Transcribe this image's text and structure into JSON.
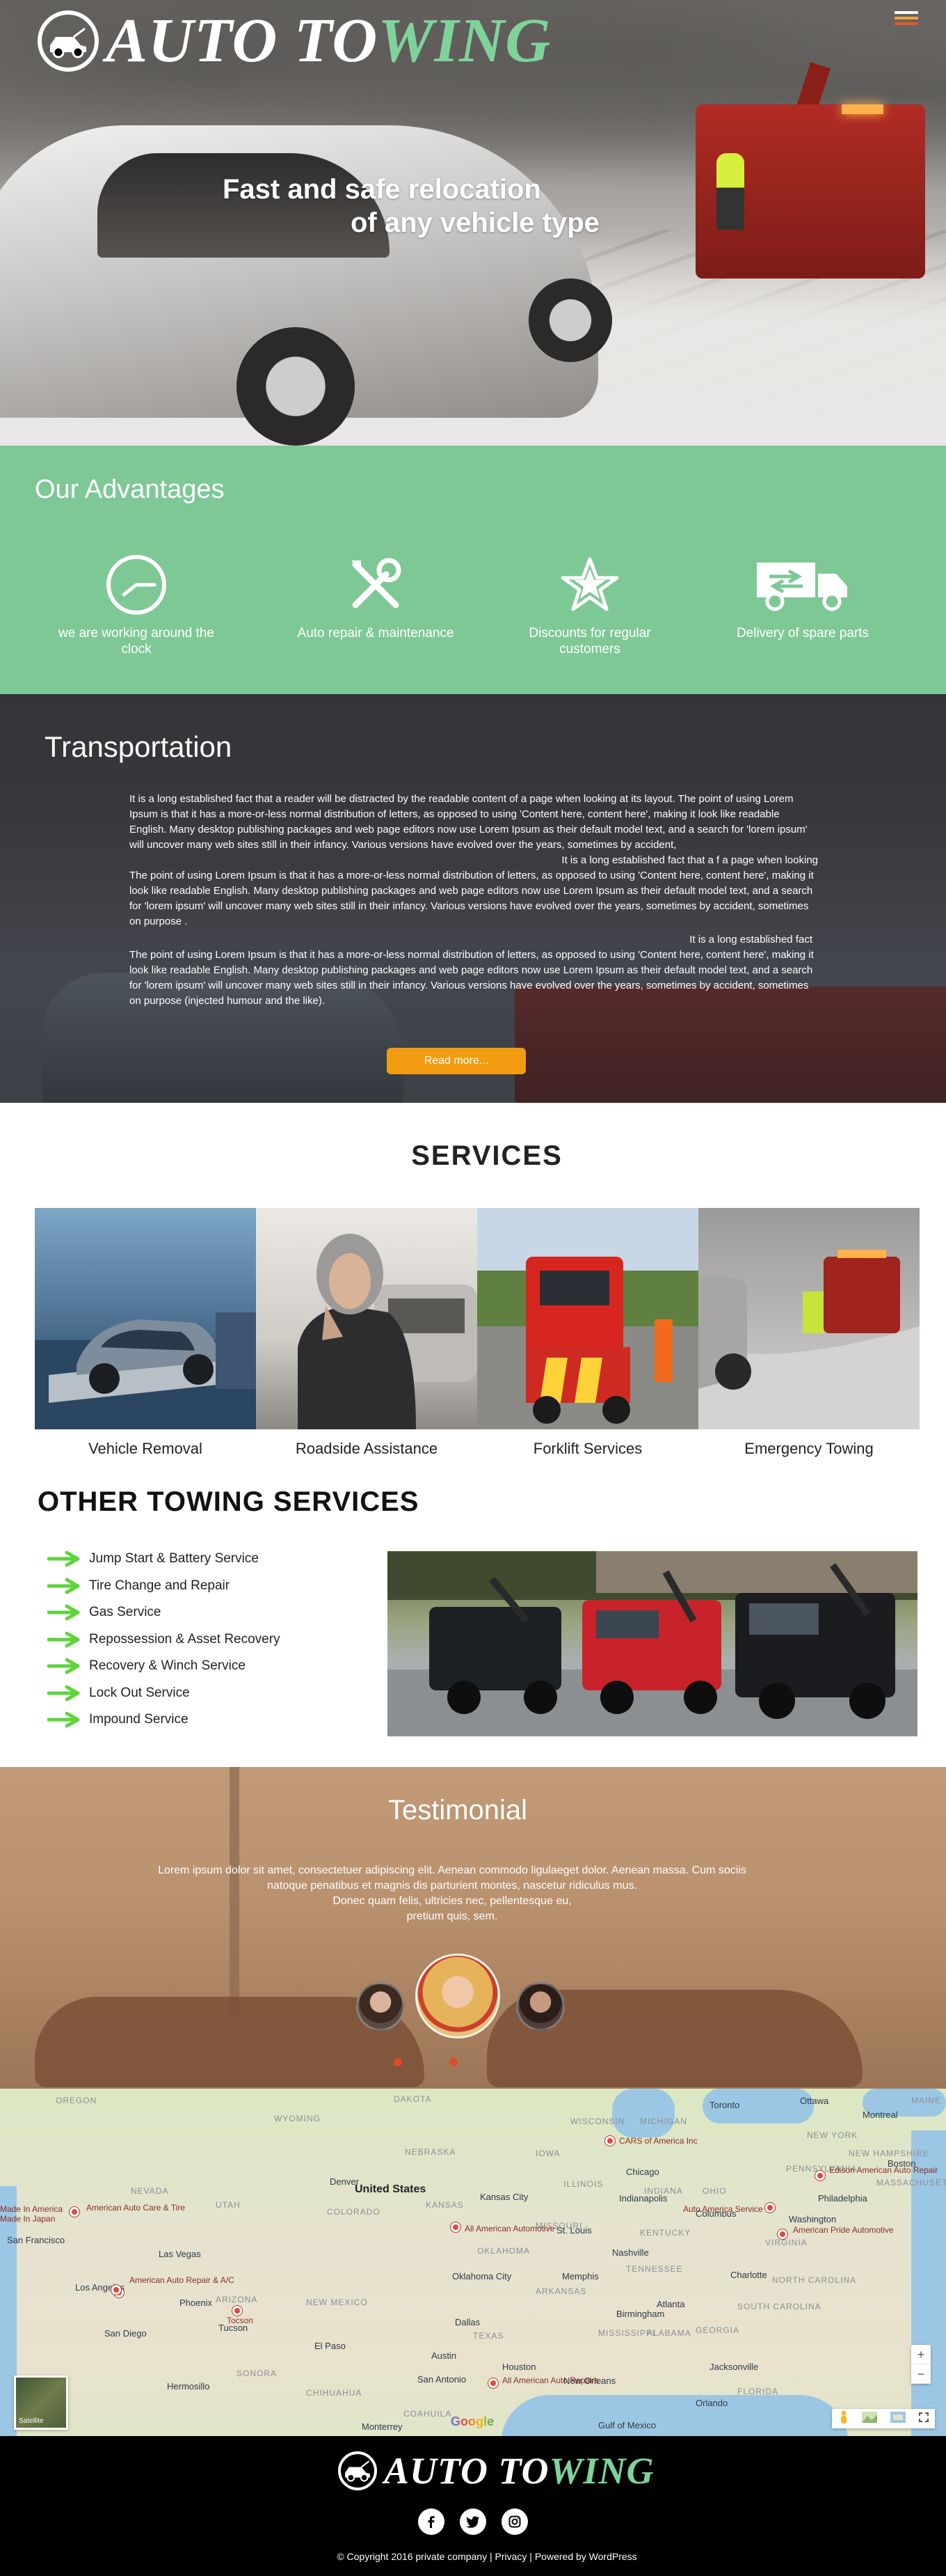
{
  "brand": {
    "word1": "AUTO TO",
    "word2": "WING",
    "accent": "#7fd39a"
  },
  "menu": {
    "colors": [
      "#ffffff",
      "#f0a23b",
      "#e05a2a"
    ]
  },
  "hero": {
    "line1": "Fast and safe relocation",
    "line2": "of any vehicle type"
  },
  "advantages": {
    "title": "Our Advantages",
    "background": "#7ec896",
    "items": [
      {
        "label": "we are working around the clock",
        "icon": "clock-icon"
      },
      {
        "label": "Auto repair & maintenance",
        "icon": "tools-icon"
      },
      {
        "label": "Discounts for regular customers",
        "icon": "star-icon"
      },
      {
        "label": "Delivery of spare parts",
        "icon": "truck-icon"
      }
    ]
  },
  "transportation": {
    "title": "Transportation",
    "p1": "It is a long established fact that a reader will be distracted by the readable content of a page when looking at its layout. The point of using Lorem Ipsum is that it has a more-or-less normal distribution of letters, as opposed to using 'Content here, content here', making it look like readable English. Many desktop publishing packages and web page editors now use Lorem Ipsum as their default model text, and a search for 'lorem ipsum' will uncover many web sites still in their infancy. Various versions have evolved over the years, sometimes by accident,",
    "p2_lead": "It is a long established fact that a f a page when looking",
    "p2": "The point of using Lorem Ipsum is that it has a more-or-less normal distribution of letters, as opposed to using 'Content here, content here', making it look like readable English. Many desktop publishing packages and web page editors now use Lorem Ipsum as their default model text, and a search for 'lorem ipsum' will uncover many web sites still in their infancy. Various versions have evolved over the years, sometimes by accident, sometimes on purpose .",
    "p3_lead": "It is a long established fact",
    "p3": "The point of using Lorem Ipsum is that it has a more-or-less normal distribution of letters, as opposed to using 'Content here, content here', making it look like readable English. Many desktop publishing packages and web page editors now use Lorem Ipsum as their default model text, and a search for 'lorem ipsum' will uncover many web sites still in their infancy. Various versions have evolved over the years, sometimes by accident, sometimes on purpose (injected humour and the like).",
    "button": "Read more...",
    "button_color": "#f39c12"
  },
  "services": {
    "title": "SERVICES",
    "items": [
      {
        "label": "Vehicle Removal"
      },
      {
        "label": "Roadside Assistance"
      },
      {
        "label": "Forklift Services"
      },
      {
        "label": "Emergency Towing"
      }
    ]
  },
  "other_services": {
    "title": "OTHER TOWING SERVICES",
    "arrow_color": "#5ed43a",
    "items": [
      "Jump Start & Battery Service",
      "Tire Change and Repair",
      "Gas Service",
      "Repossession & Asset Recovery",
      "Recovery & Winch Service",
      "Lock Out Service",
      "Impound Service"
    ]
  },
  "testimonial": {
    "title": "Testimonial",
    "line1": "Lorem ipsum dolor sit amet, consectetuer adipiscing elit. Aenean commodo ligulaeget dolor. Aenean massa. Cum sociis",
    "line2": "natoque penatibus et  magnis dis parturient montes, nascetur ridiculus mus.",
    "line3": "Donec quam felis, ultricies nec, pellentesque eu,",
    "line4": "pretium quis, sem."
  },
  "map": {
    "country": "United States",
    "states": [
      "DAKOTA",
      "WYOMING",
      "NEBRASKA",
      "NEVADA",
      "UTAH",
      "COLORADO",
      "KANSAS",
      "OKLAHOMA",
      "ARIZONA",
      "NEW MEXICO",
      "TEXAS",
      "SONORA",
      "CHIHUAHUA",
      "COAHUILA",
      "IOWA",
      "ILLINOIS",
      "MISSOURI",
      "ARKANSAS",
      "MISSISSIPPI",
      "ALABAMA",
      "GEORGIA",
      "TENNESSEE",
      "KENTUCKY",
      "INDIANA",
      "OHIO",
      "MICHIGAN",
      "WISCONSIN",
      "PENNSYLVANIA",
      "NEW YORK",
      "VIRGINIA",
      "NORTH CAROLINA",
      "SOUTH CAROLINA",
      "FLORIDA",
      "MASSACHUSETTS",
      "OREGON",
      "MAINE",
      "NEW HAMPSHIRE"
    ],
    "cities": [
      "Denver",
      "Kansas City",
      "Las Vegas",
      "Los Angeles",
      "San Francisco",
      "San Diego",
      "Tucson",
      "Phoenix",
      "El Paso",
      "Dallas",
      "Houston",
      "San Antonio",
      "Oklahoma City",
      "Chicago",
      "Indianapolis",
      "Nashville",
      "Memphis",
      "Atlanta",
      "Charlotte",
      "Jacksonville",
      "New Orleans",
      "Orlando",
      "Toronto",
      "Ottawa",
      "Montreal",
      "Boston",
      "Philadelphia",
      "Washington",
      "Columbus",
      "St. Louis",
      "Austin",
      "Birmingham",
      "Hermosillo",
      "Monterrey",
      "Gulf of Mexico"
    ],
    "places": [
      "Made In America",
      "Made In Japan",
      "American Auto Care & Tire",
      "American Auto Repair & A/C",
      "Tocson",
      "CARS of America Inc",
      "All American Automotive",
      "Auto America Service",
      "American Pride Automotive",
      "All American Auto Repairs",
      "Edison American Auto Repair"
    ],
    "satellite": "Satellite",
    "google": "Google",
    "zoom_in": "+",
    "zoom_out": "−"
  },
  "footer": {
    "copyright": "© Copyright 2016 private company",
    "privacy": "Privacy",
    "powered": "Powered by WordPress",
    "sep": " | ",
    "social": [
      "facebook-icon",
      "twitter-icon",
      "instagram-icon"
    ]
  }
}
